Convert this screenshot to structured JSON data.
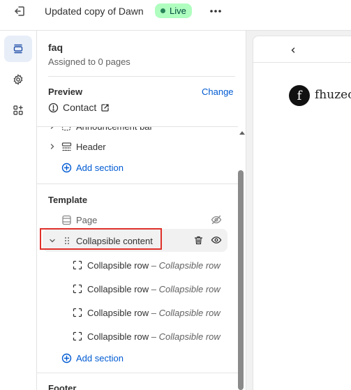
{
  "topbar": {
    "exit_icon": "exit-icon",
    "theme_name": "Updated copy of Dawn",
    "live_label": "Live",
    "more_icon": "more-horizontal-icon"
  },
  "rail": {
    "items": [
      {
        "icon": "sections-icon",
        "active": true
      },
      {
        "icon": "gear-icon",
        "active": false
      },
      {
        "icon": "apps-icon",
        "active": false
      }
    ]
  },
  "panel": {
    "title": "faq",
    "subtitle": "Assigned to 0 pages",
    "preview": {
      "label": "Preview",
      "change_label": "Change",
      "page_label": "Contact"
    },
    "header_group": {
      "partial_label": "Announcement bar",
      "header_label": "Header",
      "add_section_label": "Add section"
    },
    "template": {
      "label": "Template",
      "page_label": "Page",
      "collapsible_content_label": "Collapsible content",
      "rows": [
        {
          "name": "Collapsible row",
          "detail": "– Collapsible row"
        },
        {
          "name": "Collapsible row",
          "detail": "– Collapsible row"
        },
        {
          "name": "Collapsible row",
          "detail": "– Collapsible row"
        },
        {
          "name": "Collapsible row",
          "detail": "– Collapsible row"
        }
      ],
      "add_section_label": "Add section"
    },
    "footer_label": "Footer"
  },
  "preview_area": {
    "logo_letter": "f",
    "logo_text": "fhuzeo"
  },
  "colors": {
    "accent": "#005bd3",
    "live_bg": "#affebf",
    "live_dot": "#29845a",
    "highlight_border": "#e0302a"
  }
}
